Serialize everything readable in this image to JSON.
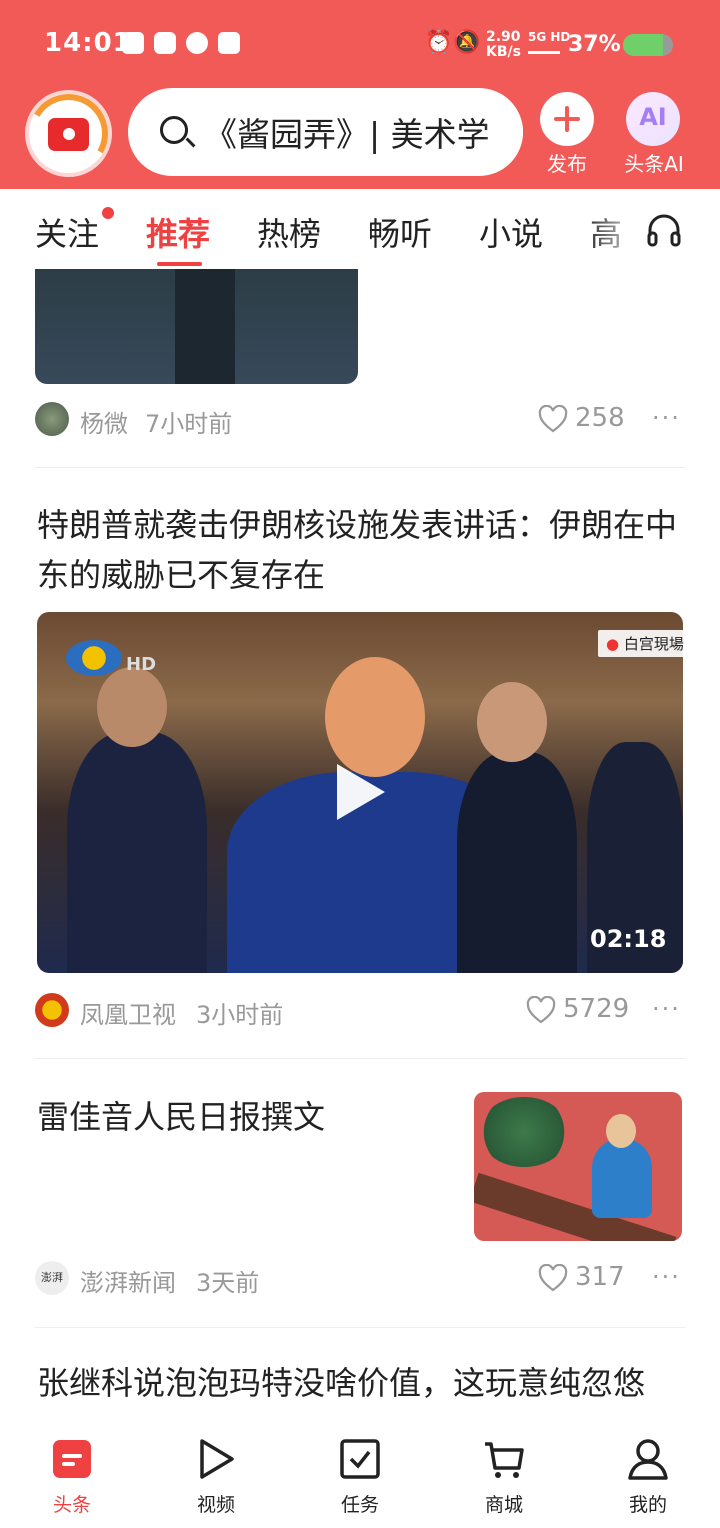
{
  "status_bar": {
    "time": "14:01",
    "network_speed": "2.90\nKB/s",
    "network_speed_top": "2.90",
    "network_speed_bottom": "KB/s",
    "signal": "5G HD",
    "battery": "37%",
    "battery_level": 0.37
  },
  "header": {
    "search_text": "《酱园弄》| 美术学",
    "publish_label": "发布",
    "ai_icon_text": "AI",
    "ai_label": "头条AI"
  },
  "tabs": {
    "items": [
      {
        "label": "关注"
      },
      {
        "label": "推荐"
      },
      {
        "label": "热榜"
      },
      {
        "label": "畅听"
      },
      {
        "label": "小说"
      },
      {
        "label": "高"
      }
    ]
  },
  "feed": {
    "item0": {
      "author": "杨微",
      "time": "7小时前",
      "likes": "258"
    },
    "item1": {
      "title": "特朗普就袭击伊朗核设施发表讲话：伊朗在中东的威胁已不复存在",
      "video_badge": "白宫現場",
      "video_hd": "HD",
      "duration": "02:18",
      "author": "凤凰卫视",
      "time": "3小时前",
      "likes": "5729"
    },
    "item2": {
      "title": "雷佳音人民日报撰文",
      "author": "澎湃新闻",
      "author_avatar_text": "澎湃",
      "time": "3天前",
      "likes": "317"
    },
    "item3": {
      "title": "张继科说泡泡玛特没啥价值，这玩意纯忽悠"
    }
  },
  "bottom_nav": {
    "items": [
      {
        "label": "头条"
      },
      {
        "label": "视频"
      },
      {
        "label": "任务"
      },
      {
        "label": "商城"
      },
      {
        "label": "我的"
      }
    ]
  },
  "colors": {
    "brand": "#f25a58",
    "accent": "#f04142"
  }
}
